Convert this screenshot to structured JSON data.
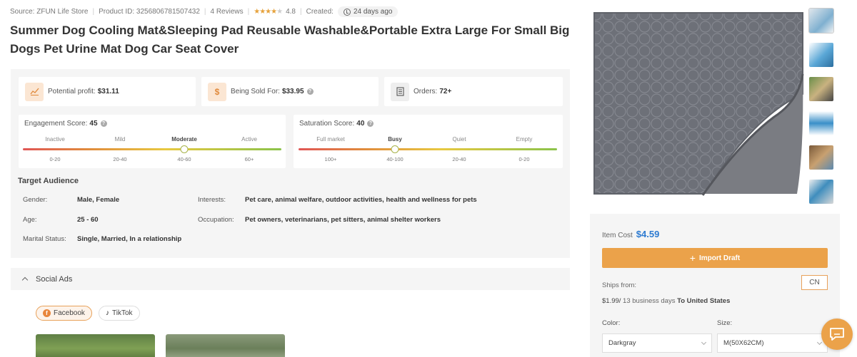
{
  "meta": {
    "source": "Source: ZFUN Life Store",
    "product_id": "Product ID: 3256806781507432",
    "reviews": "4 Reviews",
    "rating": "4.8",
    "created_label": "Created:",
    "created_value": "24 days ago"
  },
  "title": "Summer Dog Cooling Mat&Sleeping Pad Reusable Washable&Portable Extra Large For Small Big Dogs Pet Urine Mat Dog Car Seat Cover",
  "stats": {
    "profit_label": "Potential profit:",
    "profit_value": "$31.11",
    "sold_label": "Being Sold For:",
    "sold_value": "$33.95",
    "orders_label": "Orders:",
    "orders_value": "72+"
  },
  "engagement": {
    "label": "Engagement Score:",
    "value": "45",
    "levels": [
      "Inactive",
      "Mild",
      "Moderate",
      "Active"
    ],
    "ranges": [
      "0-20",
      "20-40",
      "40-60",
      "60+"
    ],
    "active_index": 2,
    "score": 45
  },
  "saturation": {
    "label": "Saturation Score:",
    "value": "40",
    "levels": [
      "Full market",
      "Busy",
      "Quiet",
      "Empty"
    ],
    "ranges": [
      "100+",
      "40-100",
      "20-40",
      "0-20"
    ],
    "active_index": 1,
    "score": 40
  },
  "audience": {
    "title": "Target Audience",
    "gender_label": "Gender:",
    "gender_value": "Male, Female",
    "age_label": "Age:",
    "age_value": "25 - 60",
    "marital_label": "Marital Status:",
    "marital_value": "Single, Married, In a relationship",
    "interests_label": "Interests:",
    "interests_value": "Pet care, animal welfare, outdoor activities, health and wellness for pets",
    "occupation_label": "Occupation:",
    "occupation_value": "Pet owners, veterinarians, pet sitters, animal shelter workers"
  },
  "social": {
    "title": "Social Ads",
    "tabs": [
      "Facebook",
      "TikTok"
    ]
  },
  "purchase": {
    "item_cost_label": "Item Cost",
    "item_cost_value": "$4.59",
    "import_label": "Import Draft",
    "ships_from_label": "Ships from:",
    "ships_from_value": "CN",
    "ship_price": "$1.99/",
    "ship_days": " 13 business days ",
    "ship_to": "To United States",
    "color_label": "Color:",
    "color_value": "Darkgray",
    "size_label": "Size:",
    "size_value": "M(50X62CM)"
  },
  "colors": {
    "accent": "#eba24a",
    "price_blue": "#2e7bd1",
    "mat_gray": "#6d7078"
  },
  "icons": [
    "chart-icon",
    "dollar-icon",
    "orders-icon",
    "clock-icon",
    "question-icon",
    "chevron-up-icon",
    "facebook-icon",
    "tiktok-icon",
    "plus-icon",
    "chevron-down-icon",
    "chat-icon"
  ]
}
